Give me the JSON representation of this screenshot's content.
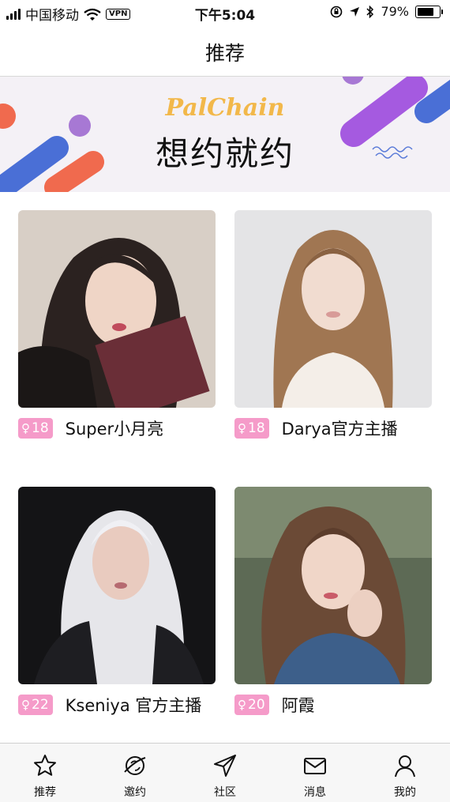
{
  "status_bar": {
    "carrier": "中国移动",
    "vpn": "VPN",
    "time": "下午5:04",
    "battery_text": "79%",
    "battery_level": 0.79
  },
  "header": {
    "title": "推荐"
  },
  "banner": {
    "brand": "PalChain",
    "slogan": "想约就约"
  },
  "cards": [
    {
      "age": "18",
      "name": "Super小月亮"
    },
    {
      "age": "18",
      "name": "Darya官方主播"
    },
    {
      "age": "22",
      "name": "Kseniya 官方主播"
    },
    {
      "age": "20",
      "name": "阿霞"
    }
  ],
  "tabbar": {
    "items": [
      {
        "label": "推荐",
        "icon": "star-icon"
      },
      {
        "label": "邀约",
        "icon": "planet-icon"
      },
      {
        "label": "社区",
        "icon": "paper-plane-icon"
      },
      {
        "label": "消息",
        "icon": "envelope-icon"
      },
      {
        "label": "我的",
        "icon": "person-icon"
      }
    ]
  },
  "colors": {
    "accent_pink": "#f59bc9",
    "brand_gold": "#f2b84a",
    "banner_bg": "#f4f1f6"
  }
}
